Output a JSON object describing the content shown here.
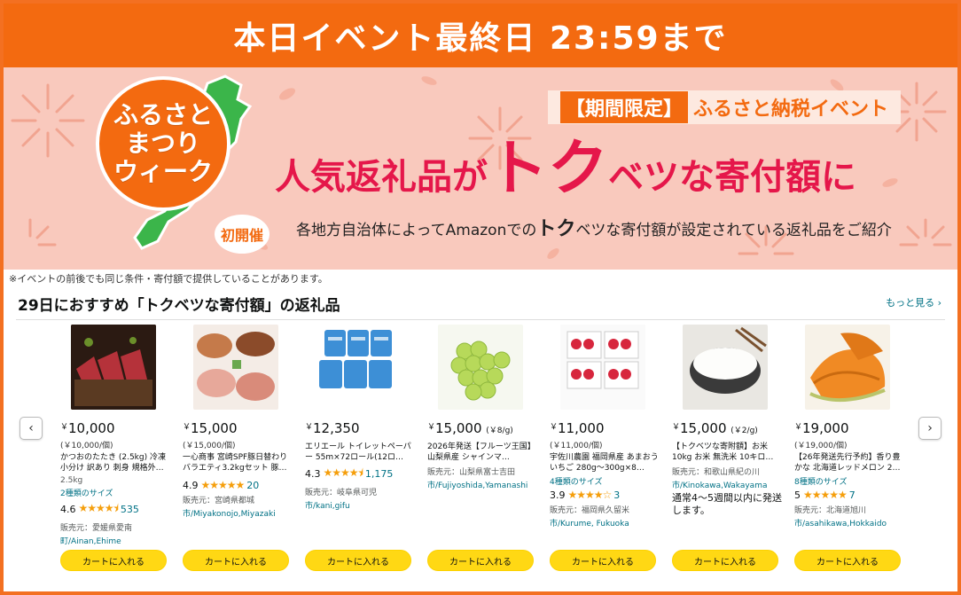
{
  "event_bar": {
    "text": "本日イベント最終日 23:59まで"
  },
  "banner": {
    "circle_lines": [
      "ふるさと",
      "まつり",
      "ウィーク"
    ],
    "badge": "初開催",
    "tag_highlight": "【期間限定】",
    "tag_text": "ふるさと納税イベント",
    "headline_1": "人気返礼品が",
    "headline_2": "トク",
    "headline_3": "ベツな寄付額に",
    "sub_1": "各地方自治体によってAmazonでの",
    "sub_2": "トク",
    "sub_3": "ベツな寄付額が設定されている返礼品をご紹介"
  },
  "note": "※イベントの前後でも同じ条件・寄付額で提供していることがあります。",
  "section": {
    "title": "29日におすすめ「トクベツな寄付額」の返礼品",
    "more": "もっと見る ›"
  },
  "nav": {
    "prev": "‹",
    "next": "›"
  },
  "products": [
    {
      "price": "10,000",
      "per": "",
      "unit": "(￥10,000/個)",
      "title": "かつおのたたき (2.5kg) 冷凍 小分け 訳あり 刺身 規格外…",
      "extra": "2.5kg",
      "variants": "2種類のサイズ",
      "rating": "4.6",
      "stars": "★★★★⯨",
      "count": "535",
      "seller_label": "",
      "seller": "販売元：愛媛県愛南",
      "seller2": "町/Ainan,Ehime",
      "cart": "カートに入れる"
    },
    {
      "price": "15,000",
      "per": "",
      "unit": "(￥15,000/個)",
      "title": "一心商事 宮崎SPF豚日替わりバラエティ3.2kgセット 豚…",
      "extra": "",
      "variants": "",
      "rating": "4.9",
      "stars": "★★★★★",
      "count": "20",
      "seller": "販売元：宮崎県都城",
      "seller2": "市/Miyakonojo,Miyazaki",
      "cart": "カートに入れる"
    },
    {
      "price": "12,350",
      "per": "",
      "unit": "",
      "title": "エリエール トイレットペーパー 55m×72ロール(12ロ…",
      "extra": "",
      "variants": "",
      "rating": "4.3",
      "stars": "★★★★⯨",
      "count": "1,175",
      "seller": "販売元：岐阜県可児",
      "seller2": "市/kani,gifu",
      "cart": "カートに入れる"
    },
    {
      "price": "15,000",
      "per": "(￥8/g)",
      "unit": "",
      "title": "2026年発送【フルーツ王国】 山梨県産 シャインマ…",
      "extra": "",
      "variants": "",
      "rating": "",
      "stars": "",
      "count": "",
      "seller": "販売元：山梨県富士吉田",
      "seller2": "市/Fujiyoshida,Yamanashi",
      "cart": "カートに入れる"
    },
    {
      "price": "11,000",
      "per": "",
      "unit": "(￥11,000/個)",
      "title": "宇佐川農園 福岡県産 あまおういちご 280g～300g×8…",
      "extra": "",
      "variants": "4種類のサイズ",
      "rating": "3.9",
      "stars": "★★★★☆",
      "count": "3",
      "seller": "販売元：福岡県久留米",
      "seller2": "市/Kurume, Fukuoka",
      "cart": "カートに入れる"
    },
    {
      "price": "15,000",
      "per": "(￥2/g)",
      "unit": "",
      "title": "【トクベツな寄附額】お米 10kg お米 無洗米 10キロ…",
      "extra": "",
      "variants": "",
      "rating": "",
      "stars": "",
      "count": "",
      "seller": "販売元：和歌山県紀の川",
      "seller2": "市/Kinokawa,Wakayama",
      "ship": "通常4～5週間以内に発送します。",
      "cart": "カートに入れる"
    },
    {
      "price": "19,000",
      "per": "",
      "unit": "(￥19,000/個)",
      "title": "【26年発送先行予約】香り豊かな 北海道レッドメロン 2…",
      "extra": "",
      "variants": "8種類のサイズ",
      "rating": "5",
      "stars": "★★★★★",
      "count": "7",
      "seller": "販売元：北海道旭川",
      "seller2": "市/asahikawa,Hokkaido",
      "cart": "カートに入れる"
    }
  ],
  "colors": {
    "accent": "#f36a10",
    "pink": "#e5174a",
    "button": "#ffd814",
    "link": "#007185"
  }
}
